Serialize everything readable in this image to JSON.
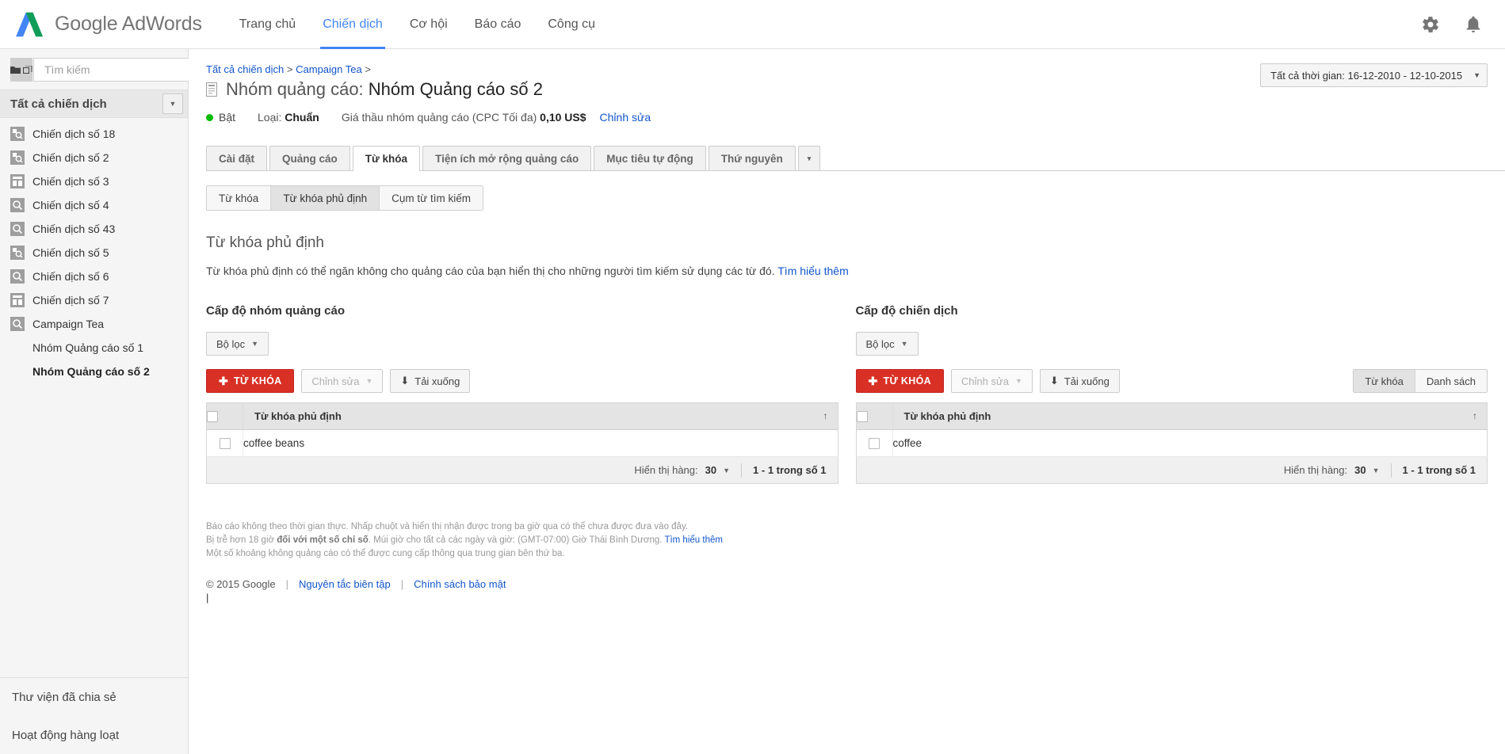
{
  "topbar": {
    "brand": "Google AdWords",
    "nav": [
      {
        "label": "Trang chủ",
        "active": false
      },
      {
        "label": "Chiến dịch",
        "active": true
      },
      {
        "label": "Cơ hội",
        "active": false
      },
      {
        "label": "Báo cáo",
        "active": false
      },
      {
        "label": "Công cụ",
        "active": false
      }
    ],
    "icons": [
      {
        "name": "gear-icon"
      },
      {
        "name": "bell-icon"
      }
    ]
  },
  "sidebar": {
    "search_placeholder": "Tìm kiếm",
    "collapse_label": "«",
    "all_campaigns": "Tất cả chiến dịch",
    "campaigns": [
      {
        "label": "Chiến dịch số 18",
        "icon": "search-display-campaign-icon"
      },
      {
        "label": "Chiến dịch số 2",
        "icon": "search-display-campaign-icon"
      },
      {
        "label": "Chiến dịch số 3",
        "icon": "display-campaign-icon"
      },
      {
        "label": "Chiến dịch số 4",
        "icon": "search-campaign-icon"
      },
      {
        "label": "Chiến dịch số 43",
        "icon": "search-campaign-icon"
      },
      {
        "label": "Chiến dịch số 5",
        "icon": "search-display-campaign-icon"
      },
      {
        "label": "Chiến dịch số 6",
        "icon": "search-campaign-icon"
      },
      {
        "label": "Chiến dịch số 7",
        "icon": "display-campaign-icon"
      },
      {
        "label": "Campaign Tea",
        "icon": "search-campaign-icon"
      }
    ],
    "adgroups": [
      {
        "label": "Nhóm Quảng cáo số 1",
        "selected": false
      },
      {
        "label": "Nhóm Quảng cáo số 2",
        "selected": true
      }
    ],
    "bottom_links": [
      {
        "label": "Thư viện đã chia sẻ"
      },
      {
        "label": "Hoạt động hàng loạt"
      }
    ]
  },
  "main": {
    "breadcrumb": {
      "item1": "Tất cả chiến dịch",
      "sep1": ">",
      "item2": "Campaign Tea",
      "sep2": ">"
    },
    "title_prefix": "Nhóm quảng cáo:",
    "title_value": "Nhóm Quảng cáo số 2",
    "status": {
      "state": "Bật",
      "type_label": "Loại:",
      "type_value": "Chuẩn",
      "bid_label": "Giá thầu nhóm quảng cáo (CPC Tối đa)",
      "bid_value": "0,10 US$",
      "edit_link": "Chỉnh sửa"
    },
    "daterange": "Tất cả thời gian: 16-12-2010 - 12-10-2015",
    "tabs": [
      {
        "label": "Cài đặt",
        "active": false
      },
      {
        "label": "Quảng cáo",
        "active": false
      },
      {
        "label": "Từ khóa",
        "active": true
      },
      {
        "label": "Tiện ích mở rộng quảng cáo",
        "active": false
      },
      {
        "label": "Mục tiêu tự động",
        "active": false
      },
      {
        "label": "Thứ nguyên",
        "active": false
      }
    ],
    "tab_more_caret": "▾",
    "subtabs": [
      {
        "label": "Từ khóa",
        "active": false
      },
      {
        "label": "Từ khóa phủ định",
        "active": true
      },
      {
        "label": "Cụm từ tìm kiếm",
        "active": false
      }
    ],
    "section_title": "Từ khóa phủ định",
    "section_desc": "Từ khóa phủ định có thể ngăn không cho quảng cáo của bạn hiển thị cho những người tìm kiếm sử dụng các từ đó.",
    "section_desc_link": "Tìm hiểu thêm"
  },
  "panels": [
    {
      "id": "adgroup-level",
      "title": "Cấp độ nhóm quảng cáo",
      "filter_label": "Bộ lọc",
      "add_button": "TỪ KHÓA",
      "edit_button": "Chỉnh sửa",
      "download_button": "Tải xuống",
      "segments": [],
      "column_header": "Từ khóa phủ định",
      "sort_arrow": "↑",
      "rows": [
        {
          "keyword": "coffee beans"
        }
      ],
      "footer": {
        "rows_label": "Hiển thị hàng:",
        "rows_value": "30",
        "count": "1 - 1 trong số 1"
      }
    },
    {
      "id": "campaign-level",
      "title": "Cấp độ chiến dịch",
      "filter_label": "Bộ lọc",
      "add_button": "TỪ KHÓA",
      "edit_button": "Chỉnh sửa",
      "download_button": "Tải xuống",
      "segments": [
        {
          "label": "Từ khóa",
          "active": true
        },
        {
          "label": "Danh sách",
          "active": false
        }
      ],
      "column_header": "Từ khóa phủ định",
      "sort_arrow": "↑",
      "rows": [
        {
          "keyword": "coffee"
        }
      ],
      "footer": {
        "rows_label": "Hiển thị hàng:",
        "rows_value": "30",
        "count": "1 - 1 trong số 1"
      }
    }
  ],
  "footer": {
    "line1": "Báo cáo không theo thời gian thực. Nhấp chuột và hiển thị nhận được trong ba giờ qua có thể chưa được đưa vào đây.",
    "line2_a": "Bị trễ hơn 18 giờ ",
    "line2_bold": "đối với một số chỉ số",
    "line2_b": ". Múi giờ cho tất cả các ngày và giờ: (GMT-07:00) Giờ Thái Bình Dương. ",
    "line2_link": "Tìm hiểu thêm",
    "line3": "Một số khoảng không quảng cáo có thể được cung cấp thông qua trung gian bên thứ ba.",
    "copyright": "© 2015 Google",
    "link1": "Nguyên tắc biên tập",
    "link2": "Chính sách bảo mật",
    "cursor": "|"
  },
  "colors": {
    "accent_blue": "#4285f4",
    "link_blue": "#1155cc",
    "red_button": "#d93025",
    "status_green": "#00bb00"
  }
}
